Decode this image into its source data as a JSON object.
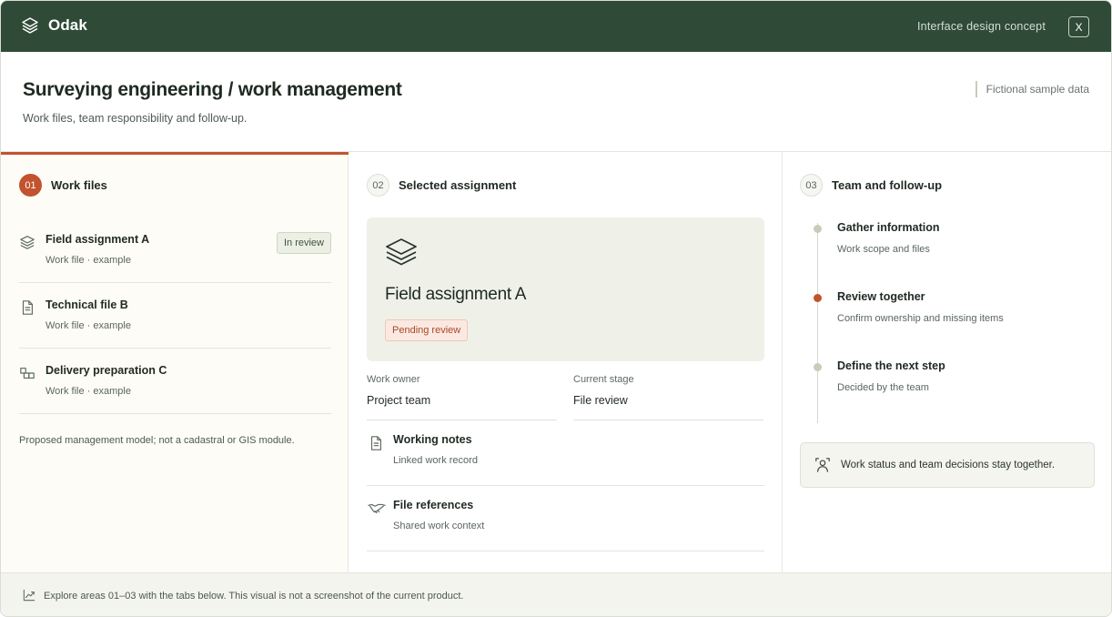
{
  "topbar": {
    "brand": "Odak",
    "concept_label": "Interface design concept",
    "close_label": "X"
  },
  "header": {
    "title": "Surveying engineering / work management",
    "subtitle": "Work files, team responsibility and follow-up.",
    "sample_note": "Fictional sample data"
  },
  "work_files": {
    "step": "01",
    "title": "Work files",
    "items": [
      {
        "name": "Field assignment A",
        "sub": "Work file · example",
        "badge": "In review",
        "icon": "layers-icon"
      },
      {
        "name": "Technical file B",
        "sub": "Work file · example",
        "badge": "",
        "icon": "document-icon"
      },
      {
        "name": "Delivery preparation C",
        "sub": "Work file · example",
        "badge": "",
        "icon": "blocks-icon"
      }
    ],
    "note": "Proposed management model; not a cadastral or GIS module."
  },
  "assignment": {
    "step": "02",
    "title": "Selected assignment",
    "name": "Field assignment A",
    "status": "Pending review",
    "owner_label": "Work owner",
    "owner_value": "Project team",
    "stage_label": "Current stage",
    "stage_value": "File review",
    "notes": [
      {
        "name": "Working notes",
        "sub": "Linked work record",
        "icon": "document-icon"
      },
      {
        "name": "File references",
        "sub": "Shared work context",
        "icon": "handshake-icon"
      }
    ]
  },
  "team": {
    "step": "03",
    "title": "Team and follow-up",
    "steps": [
      {
        "title": "Gather information",
        "sub": "Work scope and files"
      },
      {
        "title": "Review together",
        "sub": "Confirm ownership and missing items"
      },
      {
        "title": "Define the next step",
        "sub": "Decided by the team"
      }
    ],
    "status_text": "Work status and team decisions stay together."
  },
  "footer": {
    "text": "Explore areas 01–03 with the tabs below. This visual is not a screenshot of the current product."
  },
  "colors": {
    "topbar": "#2f4a37",
    "accent": "#c2532e",
    "card_bg": "#eff1e8"
  }
}
